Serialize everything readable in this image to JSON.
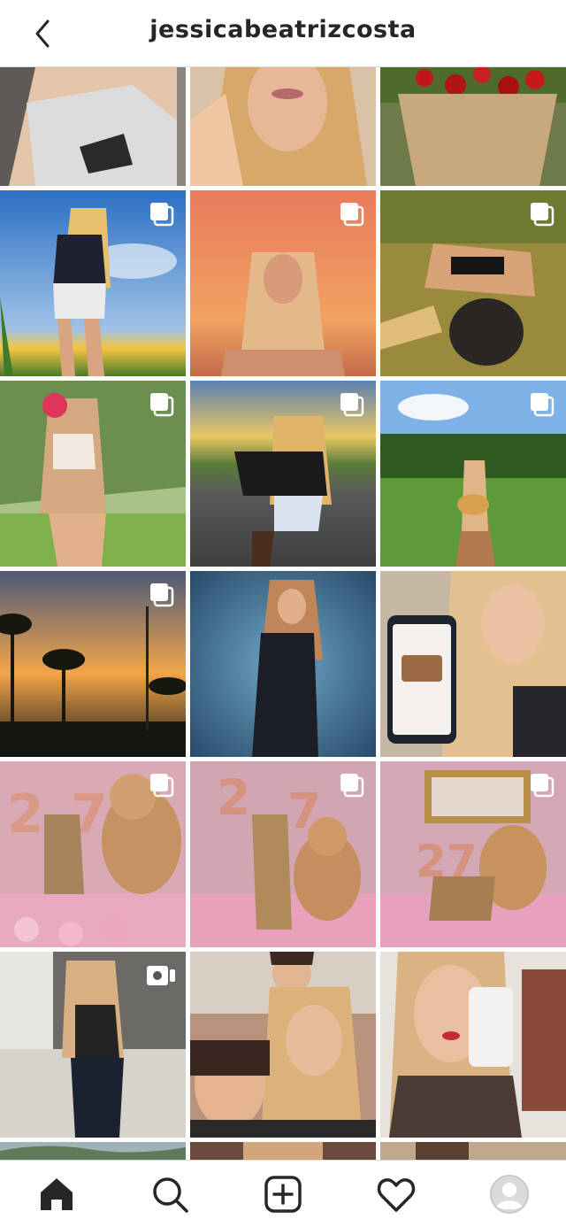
{
  "header": {
    "username": "jessicabeatrizcosta",
    "back_icon": "chevron-left-icon"
  },
  "grid": {
    "rows": [
      [
        {
          "name": "post-1",
          "depicts": "woman in grey tank top",
          "badge": "none"
        },
        {
          "name": "post-2",
          "depicts": "blonde woman close-up",
          "badge": "none"
        },
        {
          "name": "post-3",
          "depicts": "bouquet of red roses",
          "badge": "none"
        }
      ],
      [
        {
          "name": "post-4",
          "depicts": "woman under blue sky",
          "badge": "carousel"
        },
        {
          "name": "post-5",
          "depicts": "woman at orange sunset",
          "badge": "carousel"
        },
        {
          "name": "post-6",
          "depicts": "woman lying on grass with hat",
          "badge": "carousel"
        }
      ],
      [
        {
          "name": "post-7",
          "depicts": "woman with palm trees",
          "badge": "carousel"
        },
        {
          "name": "post-8",
          "depicts": "woman crouching on road",
          "badge": "carousel"
        },
        {
          "name": "post-9",
          "depicts": "woman on garden path",
          "badge": "carousel"
        }
      ],
      [
        {
          "name": "post-10",
          "depicts": "palm trees at sunset",
          "badge": "carousel"
        },
        {
          "name": "post-11",
          "depicts": "woman in black dress",
          "badge": "none"
        },
        {
          "name": "post-12",
          "depicts": "woman holding phone",
          "badge": "none"
        }
      ],
      [
        {
          "name": "post-13",
          "depicts": "birthday 27 with teddy bear",
          "badge": "carousel"
        },
        {
          "name": "post-14",
          "depicts": "birthday 27 standing",
          "badge": "carousel"
        },
        {
          "name": "post-15",
          "depicts": "birthday 27 sitting",
          "badge": "carousel"
        }
      ],
      [
        {
          "name": "post-16",
          "depicts": "woman in bedroom",
          "badge": "video"
        },
        {
          "name": "post-17",
          "depicts": "selfie with children",
          "badge": "none"
        },
        {
          "name": "post-18",
          "depicts": "mirror selfie",
          "badge": "none"
        }
      ]
    ]
  },
  "tabbar": {
    "items": [
      {
        "name": "home-tab",
        "icon": "home-icon"
      },
      {
        "name": "search-tab",
        "icon": "search-icon"
      },
      {
        "name": "new-post-tab",
        "icon": "plus-square-icon"
      },
      {
        "name": "activity-tab",
        "icon": "heart-icon"
      },
      {
        "name": "profile-tab",
        "icon": "avatar-icon"
      }
    ]
  }
}
